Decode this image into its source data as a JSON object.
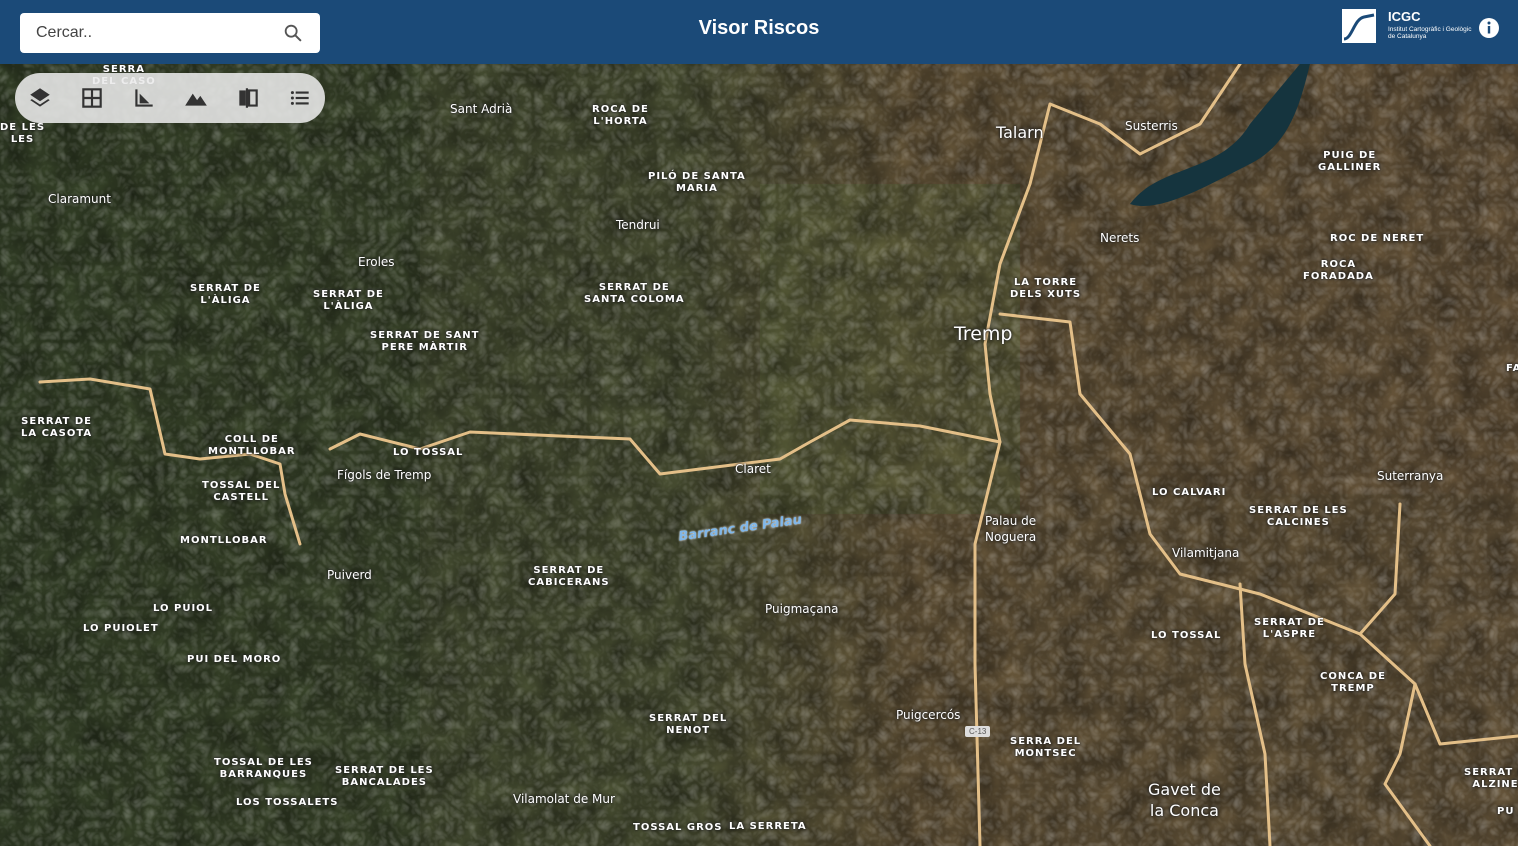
{
  "header": {
    "title": "Visor Riscos",
    "search_placeholder": "Cercar..",
    "logo_name": "ICGC",
    "logo_sub": "Institut Cartogràfic i Geològic de Catalunya",
    "bg_color": "#1b4a78"
  },
  "toolbar": {
    "icons": [
      "layers-icon",
      "grid-icon",
      "ruler-icon",
      "terrain-icon",
      "compare-icon",
      "list-icon"
    ]
  },
  "map": {
    "road_badge": "C-13",
    "labels": {
      "serra_del_caso": "SERRA\nDEL CASO",
      "de_les": "DE LES\nLES",
      "sant_adria": "Sant Adrià",
      "roca_horta": "ROCA DE\nL'HORTA",
      "talarn": "Talarn",
      "susterris": "Susterris",
      "puig_galliner": "PUIG DE\nGALLINER",
      "claramunt": "Claramunt",
      "pilo_santa_maria": "PILÓ DE SANTA\nMARIA",
      "tendrui": "Tendrui",
      "nerets": "Nerets",
      "roc_neret": "ROC DE NERET",
      "roca_foradada": "ROCA\nFORADADA",
      "eroles": "Eroles",
      "serrat_aliga1": "SERRAT DE\nL'ÀLIGA",
      "serrat_aliga2": "SERRAT DE\nL'ÀLIGA",
      "serrat_santa_coloma": "SERRAT DE\nSANTA COLOMA",
      "la_torre": "LA TORRE\nDELS XUTS",
      "tremp": "Tremp",
      "serrat_pere_martir": "SERRAT DE SANT\nPERE MÀRTIR",
      "fa": "FA",
      "serrat_casota": "SERRAT DE\nLA CASOTA",
      "coll_montllobar": "COLL DE\nMONTLLOBAR",
      "lo_tossal1": "LO TOSSAL",
      "figols": "Fígols de Tremp",
      "claret": "Claret",
      "tossal_castell": "TOSSAL DEL\nCASTELL",
      "lo_calvari": "LO CALVARI",
      "suterranya": "Suterranya",
      "serrat_calcines": "SERRAT DE LES\nCALCINES",
      "palau_noguera": "Palau de\nNoguera",
      "barranc_palau": "Barranc de Palau",
      "montllobar": "MONTLLOBAR",
      "vilamitjana": "Vilamitjana",
      "puiverd": "Puiverd",
      "serrat_cabicerans": "SERRAT DE\nCABICERANS",
      "lo_puiol": "LO PUIOL",
      "puigmacana": "Puigmaçana",
      "lo_tossal2": "LO TOSSAL",
      "serrat_aspre": "SERRAT DE\nL'ASPRE",
      "lo_puiolet": "LO PUIOLET",
      "pui_moro": "PUI DEL MORO",
      "conca_tremp": "CONCA DE\nTREMP",
      "puigcercos": "Puigcercós",
      "serrat_nenot": "SERRAT DEL\nNENOT",
      "serra_montsec": "SERRA DEL\nMONTSEC",
      "tossal_barranques": "TOSSAL DE LES\nBARRANQUES",
      "serrat_bancalades": "SERRAT DE LES\nBANCALADES",
      "gavet_conca": "Gavet de\nla Conca",
      "serrat_alzine": "SERRAT D\nALZINE",
      "los_tossalets": "LOS TOSSALETS",
      "vilamolat": "Vilamolat de Mur",
      "pu": "PU",
      "tossal_gros": "TOSSAL GROS",
      "la_serreta": "LA SERRETA"
    }
  }
}
